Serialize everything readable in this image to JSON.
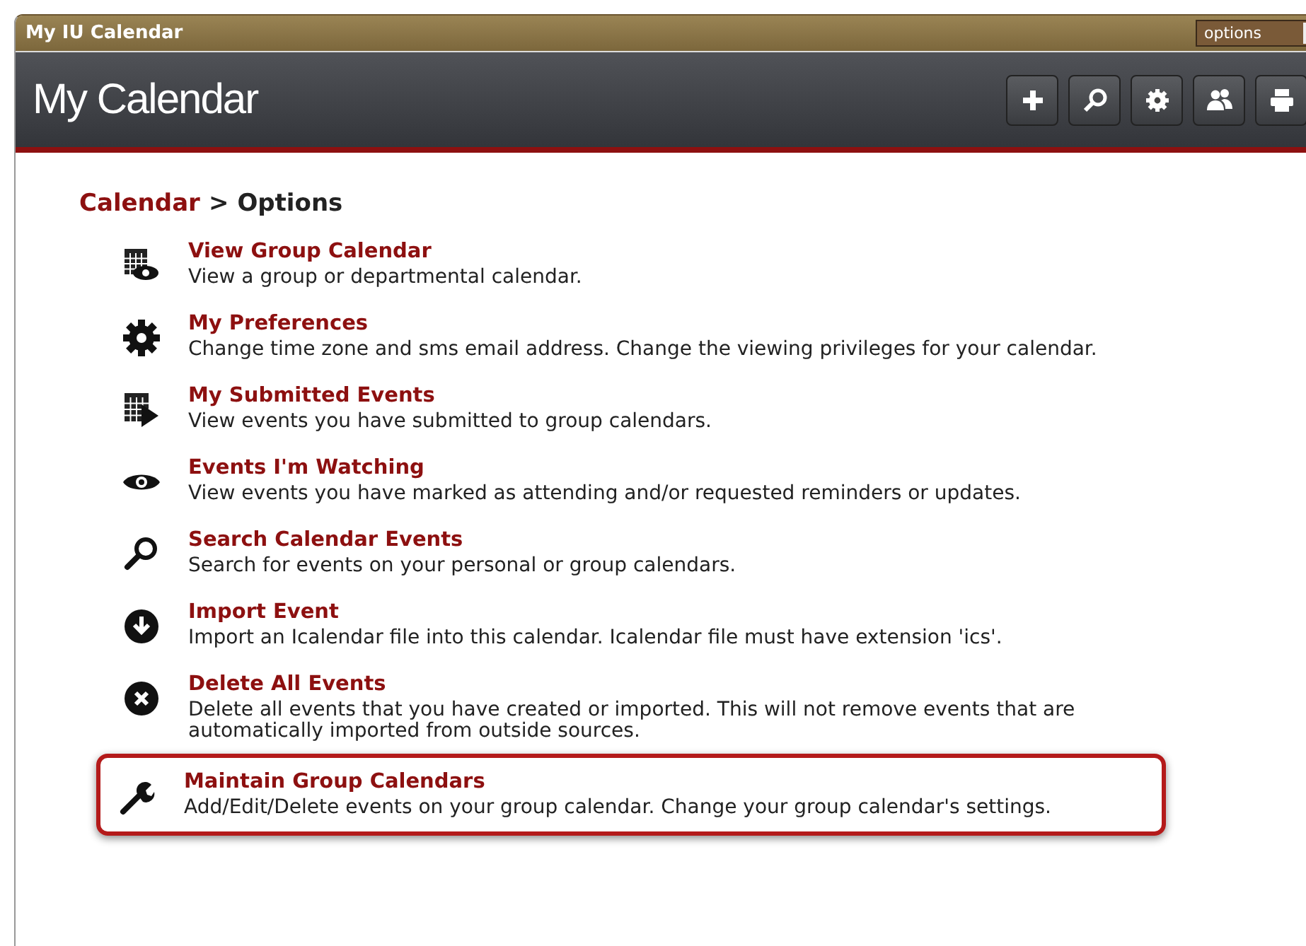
{
  "window": {
    "title": "My IU Calendar",
    "view_select": {
      "value": "options"
    }
  },
  "header": {
    "title": "My Calendar",
    "buttons": [
      {
        "kind": "plus"
      },
      {
        "kind": "search"
      },
      {
        "kind": "gear"
      },
      {
        "kind": "people"
      },
      {
        "kind": "printer"
      }
    ]
  },
  "breadcrumb": {
    "link": "Calendar",
    "separator": ">",
    "current": "Options"
  },
  "items": [
    {
      "kind": "calendar-eye",
      "title": "View Group Calendar",
      "description": "View a group or departmental calendar.",
      "highlighted": false
    },
    {
      "kind": "gear",
      "title": "My Preferences",
      "description": "Change time zone and sms email address. Change the viewing privileges for your calendar.",
      "highlighted": false
    },
    {
      "kind": "calendar-play",
      "title": "My Submitted Events",
      "description": "View events you have submitted to group calendars.",
      "highlighted": false
    },
    {
      "kind": "eye",
      "title": "Events I'm Watching",
      "description": "View events you have marked as attending and/or requested reminders or updates.",
      "highlighted": false
    },
    {
      "kind": "search",
      "title": "Search Calendar Events",
      "description": "Search for events on your personal or group calendars.",
      "highlighted": false
    },
    {
      "kind": "download",
      "title": "Import Event",
      "description": "Import an Icalendar file into this calendar. Icalendar file must have extension 'ics'.",
      "highlighted": false
    },
    {
      "kind": "delete",
      "title": "Delete All Events",
      "description": "Delete all events that you have created or imported. This will not remove events that are automatically imported from outside sources.",
      "highlighted": false
    },
    {
      "kind": "wrench",
      "title": "Maintain Group Calendars",
      "description": "Add/Edit/Delete events on your group calendar. Change your group calendar's settings.",
      "highlighted": true
    }
  ]
}
